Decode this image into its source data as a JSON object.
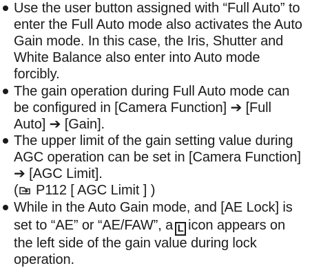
{
  "bullets": [
    {
      "lines": [
        "Use the user button assigned with “Full Auto” to",
        "enter the Full Auto mode also activates the Auto",
        "Gain mode. In this case, the Iris, Shutter and",
        "White Balance also enter into Auto mode",
        "forcibly."
      ]
    },
    {
      "lines": [
        "The gain operation during Full Auto mode can",
        "be configured in [Camera Function] ➔ [Full",
        "Auto] ➔ [Gain]."
      ]
    },
    {
      "lines": [
        "The upper limit of the gain setting value during",
        "AGC operation can be set in [Camera Function]",
        "➔ [AGC Limit]."
      ],
      "reference": {
        "open": "(",
        "text": " P112 [ AGC Limit ] )",
        "icon": "page-reference-icon"
      }
    },
    {
      "lines_part1": "While in the Auto Gain mode, and [AE Lock] is",
      "line2_before": "set to “AE” or “AE/FAW”, a",
      "lock_icon_label": "L",
      "line2_after": "icon appears on",
      "line3": "the left side of the gain value during lock",
      "line4": "operation."
    }
  ]
}
